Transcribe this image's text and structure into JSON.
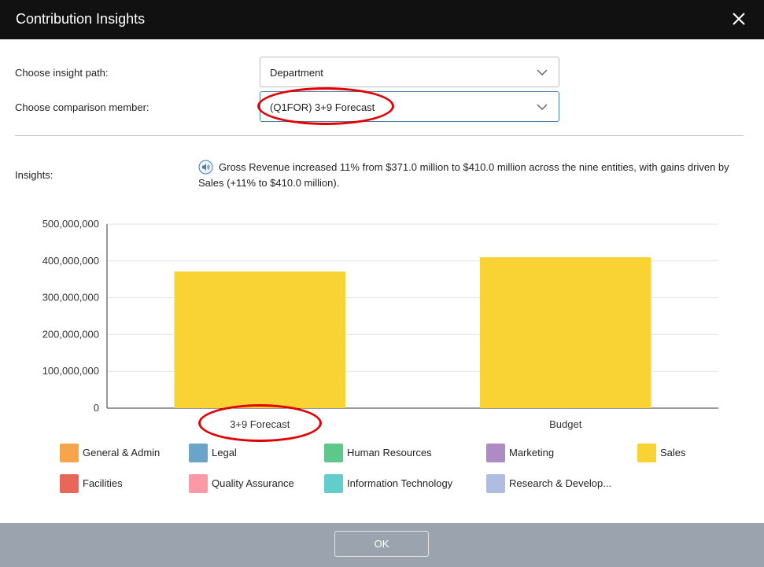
{
  "dialog": {
    "title": "Contribution Insights",
    "close_icon": "close-icon"
  },
  "form": {
    "insight_path_label": "Choose insight path:",
    "insight_path_value": "Department",
    "comparison_label": "Choose comparison member:",
    "comparison_value": "(Q1FOR) 3+9 Forecast"
  },
  "insights": {
    "label": "Insights:",
    "icon": "speaker-icon",
    "text": "Gross Revenue increased 11% from $371.0 million to $410.0 million across the nine entities, with gains driven by Sales (+11% to $410.0 million)."
  },
  "chart_data": {
    "type": "bar",
    "categories": [
      "3+9 Forecast",
      "Budget"
    ],
    "series": [
      {
        "name": "Sales",
        "values": [
          371000000,
          410000000
        ],
        "color": "#f9d233"
      }
    ],
    "ylim": [
      0,
      500000000
    ],
    "yticks": [
      "0",
      "100,000,000",
      "200,000,000",
      "300,000,000",
      "400,000,000",
      "500,000,000"
    ],
    "grid": true
  },
  "legend": [
    {
      "label": "General & Admin",
      "color": "#f7a54a"
    },
    {
      "label": "Legal",
      "color": "#6aa5c8"
    },
    {
      "label": "Human Resources",
      "color": "#5dc889"
    },
    {
      "label": "Marketing",
      "color": "#ad8cc4"
    },
    {
      "label": "Sales",
      "color": "#f9d233"
    },
    {
      "label": "Facilities",
      "color": "#e9675a"
    },
    {
      "label": "Quality Assurance",
      "color": "#fb9aa6"
    },
    {
      "label": "Information Technology",
      "color": "#62cdcb"
    },
    {
      "label": "Research & Develop...",
      "color": "#afbde0"
    }
  ],
  "footer": {
    "ok_label": "OK"
  },
  "colors": {
    "titlebar": "#111111",
    "footer": "#9ba3ae",
    "highlight": "#e30000"
  }
}
